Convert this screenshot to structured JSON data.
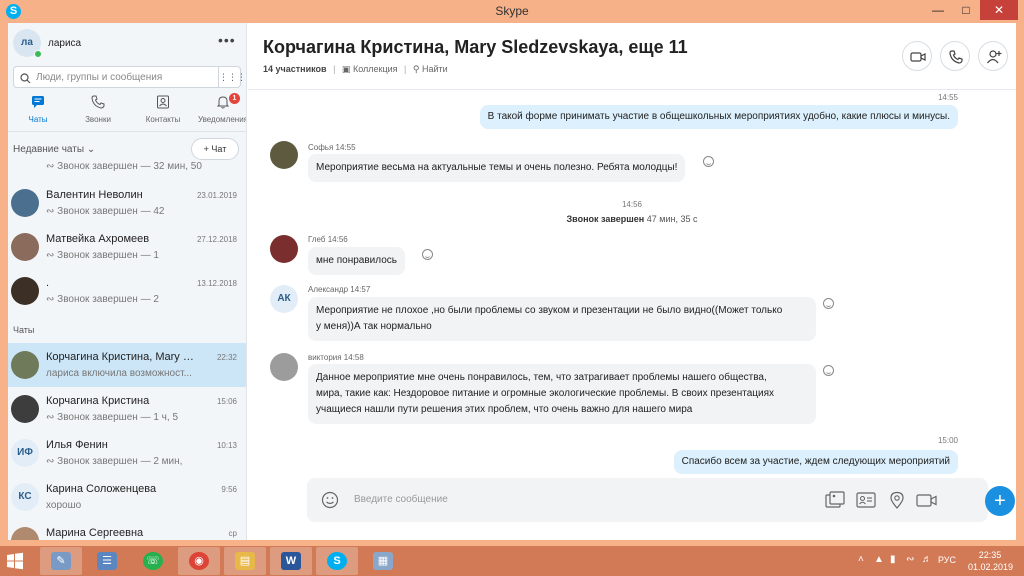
{
  "window": {
    "title": "Skype"
  },
  "profile": {
    "initials": "ла",
    "name": "лариса"
  },
  "search": {
    "placeholder": "Люди, группы и сообщения"
  },
  "nav": {
    "tabs": [
      {
        "label": "Чаты",
        "icon": "chat-icon"
      },
      {
        "label": "Звонки",
        "icon": "phone-icon"
      },
      {
        "label": "Контакты",
        "icon": "contacts-icon"
      },
      {
        "label": "Уведомления",
        "icon": "bell-icon",
        "badge": "1"
      }
    ]
  },
  "recent": {
    "header": "Недавние чаты",
    "new_chat_label": "Чат",
    "items": [
      {
        "name": "",
        "date": "",
        "sub": "Звонок завершен — 32 мин, 50"
      },
      {
        "name": "Валентин Неволин",
        "date": "23.01.2019",
        "sub": "Звонок завершен — 42"
      },
      {
        "name": "Матвейка Ахромеев",
        "date": "27.12.2018",
        "sub": "Звонок завершен — 1"
      },
      {
        "name": ".",
        "date": "13.12.2018",
        "sub": "Звонок завершен — 2"
      }
    ]
  },
  "chats": {
    "header": "Чаты",
    "items": [
      {
        "name": "Корчагина Кристина, Mary Sl...",
        "date": "22:32",
        "sub": "лариса включила возможност..."
      },
      {
        "name": "Корчагина Кристина",
        "date": "15:06",
        "sub": "Звонок завершен — 1 ч, 5"
      },
      {
        "name": "Илья Фенин",
        "initials": "ИФ",
        "date": "10:13",
        "sub": "Звонок завершен — 2 мин,"
      },
      {
        "name": "Карина Соложенцева",
        "initials": "КС",
        "date": "9:56",
        "sub": "хорошо"
      },
      {
        "name": "Марина Сергеевна",
        "date": "ср",
        "sub": ""
      }
    ]
  },
  "conversation": {
    "title": "Корчагина Кристина, Mary Sledzevskaya, еще 11",
    "participants": "14 участников",
    "collection": "Коллекция",
    "find": "Найти"
  },
  "messages": {
    "m1": {
      "time": "14:55",
      "text": "В такой форме принимать участие в общешкольных мероприятиях удобно, какие плюсы и минусы."
    },
    "m2": {
      "sender": "Софья 14:55",
      "text": "Мероприятие весьма на актуальные темы и очень полезно. Ребята молодцы!"
    },
    "sys": {
      "time": "14:56",
      "call_label": "Звонок завершен",
      "call_duration": "47 мин, 35 с"
    },
    "m3": {
      "sender": "Глеб 14:56",
      "text": "мне понравилось"
    },
    "m4": {
      "sender": "Александр 14:57",
      "initials": "АК",
      "line1": "Мероприятие не плохое ,но были проблемы со звуком и презентации не было видно((Может только",
      "line2": "у меня))А так нормально"
    },
    "m5": {
      "sender": "виктория 14:58",
      "line1": "Данное мероприятие мне очень понравилось, тем, что затрагивает проблемы нашего общества,",
      "line2": "мира, такие как: Нездоровое питание и огромные экологические проблемы. В своих презентациях",
      "line3": "учащиеся нашли пути решения этих проблем, что очень важно для нашего мира"
    },
    "m6": {
      "time": "15:00",
      "text": "Спасибо всем за участие, ждем  следующих мероприятий"
    }
  },
  "composer": {
    "placeholder": "Введите сообщение"
  },
  "taskbar": {
    "lang": "РУС",
    "time": "22:35",
    "date": "01.02.2019"
  }
}
